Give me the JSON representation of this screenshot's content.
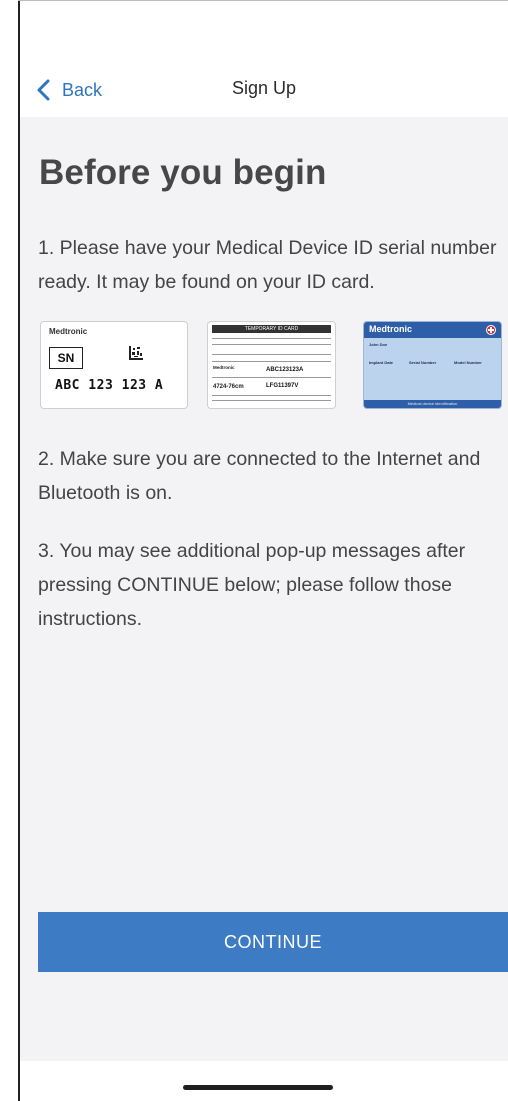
{
  "nav": {
    "back_label": "Back",
    "title": "Sign Up"
  },
  "content": {
    "heading": "Before you begin",
    "step1": "1. Please have your Medical Device ID serial number ready. It may be found on your ID card.",
    "step2": "2. Make sure you are connected to the Internet and Bluetooth is on.",
    "step3": "3. You may see additional pop-up messages after pressing CONTINUE below; please follow those instructions."
  },
  "cards": {
    "card1": {
      "brand": "Medtronic",
      "sn_label": "SN",
      "serial": "ABC 123 123 A"
    },
    "card2": {
      "header": "TEMPORARY ID CARD",
      "brand": "Medtronic",
      "serial": "ABC123123A",
      "model": "4724-76cm",
      "lot": "LFG11397V"
    },
    "card3": {
      "brand": "Medtronic",
      "name": "John Doe",
      "col1": "Implant Date",
      "col2": "Serial Number",
      "col3": "Model Number",
      "footer": "Medical device identification"
    }
  },
  "actions": {
    "continue_label": "CONTINUE"
  },
  "colors": {
    "accent": "#2f74c0",
    "button": "#3d7cc4",
    "background": "#f3f3f6"
  }
}
